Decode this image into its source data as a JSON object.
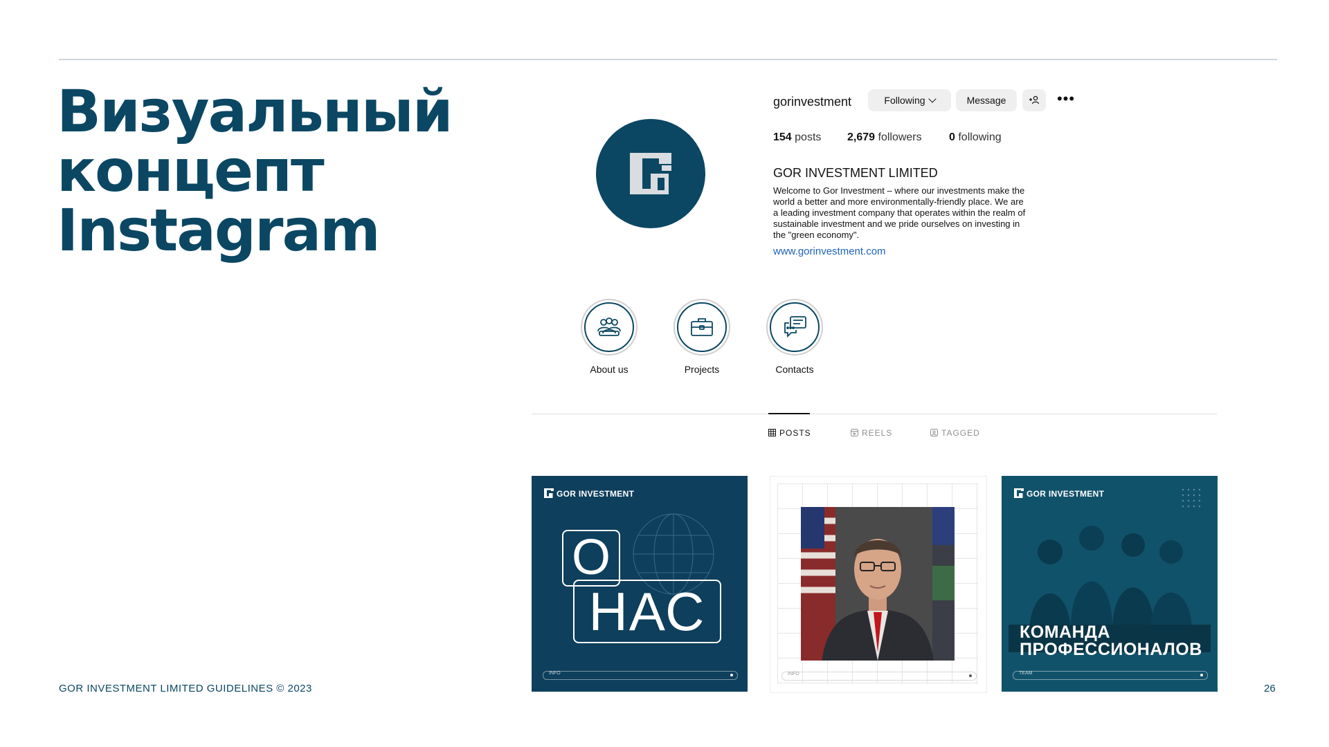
{
  "slide": {
    "title_lines": [
      "Визуальный",
      "концепт",
      "Instagram"
    ],
    "footer_left": "GOR INVESTMENT LIMITED GUIDELINES © 2023",
    "page_number": "26"
  },
  "profile": {
    "username": "gorinvestment",
    "buttons": {
      "following": "Following",
      "message": "Message",
      "more": "•••"
    },
    "stats": {
      "posts_count": "154",
      "posts_label": "posts",
      "followers_count": "2,679",
      "followers_label": "followers",
      "following_count": "0",
      "following_label": "following"
    },
    "bio": {
      "name": "GOR INVESTMENT LIMITED",
      "text": "Welcome to Gor Investment – where our investments make the world a better and more environmentally-friendly place. We are a leading investment company that operates within the realm of sustainable investment and we pride ourselves on investing in the \"green economy\".",
      "link": "www.gorinvestment.com"
    },
    "highlights": [
      {
        "label": "About us",
        "icon": "team-icon"
      },
      {
        "label": "Projects",
        "icon": "briefcase-icon"
      },
      {
        "label": "Contacts",
        "icon": "chat-icon"
      }
    ],
    "tabs": [
      "POSTS",
      "REELS",
      "TAGGED"
    ],
    "accent_color": "#0b4763",
    "link_color": "#1f64b8"
  },
  "posts": [
    {
      "brand": "GOR INVESTMENT",
      "line1": "О",
      "line2": "НАС",
      "footer": "INFO"
    },
    {
      "footer": "INFO"
    },
    {
      "brand": "GOR INVESTMENT",
      "caption_lines": [
        "КОМАНДА",
        "ПРОФЕССИОНАЛОВ"
      ],
      "footer": "TEAM"
    }
  ]
}
